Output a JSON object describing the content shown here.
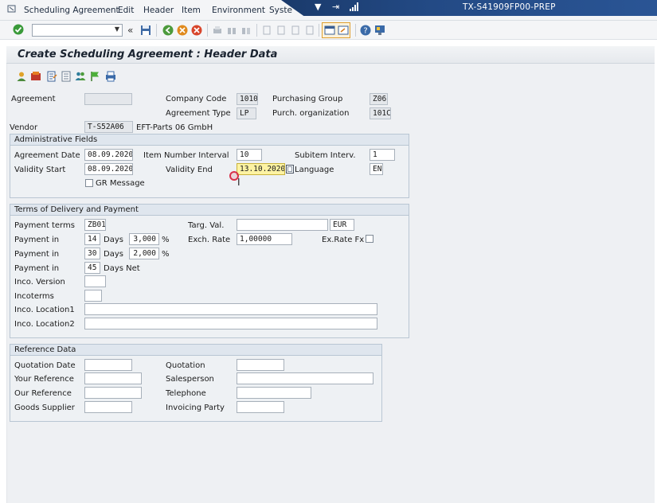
{
  "menubar": {
    "items": [
      "Scheduling Agreement",
      "Edit",
      "Header",
      "Item",
      "Environment",
      "Syste"
    ],
    "system_id": "TX-S41909FP00-PREP"
  },
  "toolbar": {
    "command_field_value": ""
  },
  "page": {
    "title": "Create Scheduling Agreement : Header Data"
  },
  "header": {
    "agreement_label": "Agreement",
    "agreement_value": "",
    "company_code_label": "Company Code",
    "company_code_value": "1010",
    "purchasing_group_label": "Purchasing Group",
    "purchasing_group_value": "Z06",
    "agreement_type_label": "Agreement Type",
    "agreement_type_value": "LP",
    "purch_org_label": "Purch. organization",
    "purch_org_value": "101C",
    "vendor_label": "Vendor",
    "vendor_value": "T-S52A06",
    "vendor_name": "EFT-Parts 06 GmbH"
  },
  "admin": {
    "title": "Administrative Fields",
    "agreement_date_label": "Agreement Date",
    "agreement_date_value": "08.09.2020",
    "item_number_interval_label": "Item Number Interval",
    "item_number_interval_value": "10",
    "subitem_interv_label": "Subitem Interv.",
    "subitem_interv_value": "1",
    "validity_start_label": "Validity Start",
    "validity_start_value": "08.09.2020",
    "validity_end_label": "Validity End",
    "validity_end_value": "13.10.2020",
    "language_label": "Language",
    "language_value": "EN",
    "gr_message_label": "GR Message"
  },
  "terms": {
    "title": "Terms of Delivery and Payment",
    "payment_terms_label": "Payment terms",
    "payment_terms_value": "ZB01",
    "targ_val_label": "Targ. Val.",
    "targ_val_value": "",
    "currency_value": "EUR",
    "payment_in_label": "Payment in",
    "days_label": "Days",
    "percent_label": "%",
    "days_net_label": "Days Net",
    "pay1_days": "14",
    "pay1_pct": "3,000",
    "pay2_days": "30",
    "pay2_pct": "2,000",
    "pay3_days": "45",
    "exch_rate_label": "Exch. Rate",
    "exch_rate_value": "1,00000",
    "exrate_fx_label": "Ex.Rate Fx",
    "inco_version_label": "Inco. Version",
    "incoterms_label": "Incoterms",
    "inco_loc1_label": "Inco. Location1",
    "inco_loc2_label": "Inco. Location2"
  },
  "reference": {
    "title": "Reference Data",
    "quotation_date_label": "Quotation Date",
    "quotation_label": "Quotation",
    "your_reference_label": "Your Reference",
    "salesperson_label": "Salesperson",
    "our_reference_label": "Our Reference",
    "telephone_label": "Telephone",
    "goods_supplier_label": "Goods Supplier",
    "invoicing_party_label": "Invoicing Party"
  },
  "colors": {
    "title_strip": "#234a85",
    "highlight_field": "#fdf3a3",
    "group_header": "#dfe6ee"
  }
}
